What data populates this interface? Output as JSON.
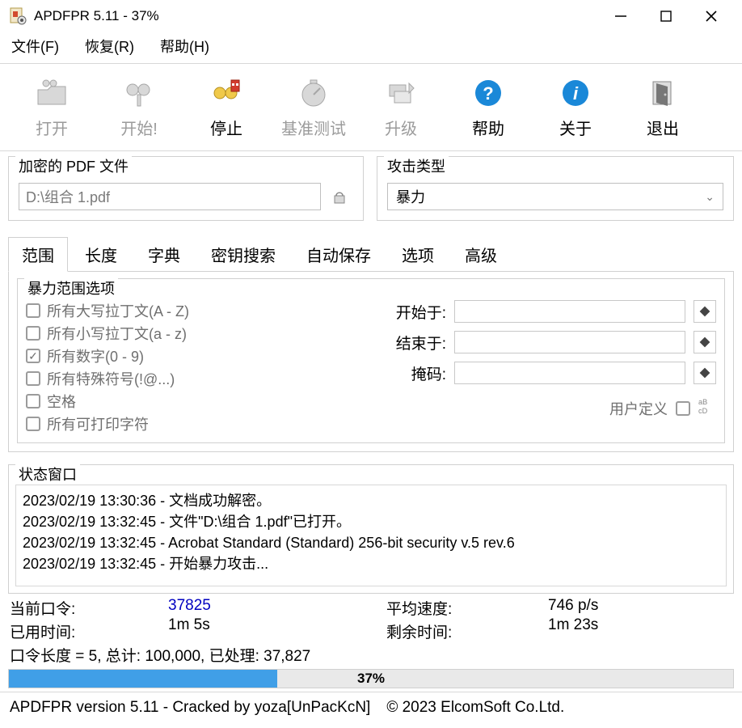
{
  "window": {
    "title": "APDFPR 5.11 - 37%"
  },
  "menu": {
    "file": "文件(F)",
    "recover": "恢复(R)",
    "help": "帮助(H)"
  },
  "toolbar": {
    "open": "打开",
    "start": "开始!",
    "stop": "停止",
    "benchmark": "基准测试",
    "upgrade": "升级",
    "help": "帮助",
    "about": "关于",
    "exit": "退出"
  },
  "groups": {
    "file_legend": "加密的 PDF 文件",
    "file_value": "D:\\组合 1.pdf",
    "attack_legend": "攻击类型",
    "attack_value": "暴力"
  },
  "tabs": {
    "range": "范围",
    "length": "长度",
    "dict": "字典",
    "keysearch": "密钥搜索",
    "autosave": "自动保存",
    "options": "选项",
    "advanced": "高级"
  },
  "brute": {
    "legend": "暴力范围选项",
    "upper": "所有大写拉丁文(A - Z)",
    "lower": "所有小写拉丁文(a - z)",
    "digits": "所有数字(0 - 9)",
    "special": "所有特殊符号(!@...)",
    "space": "空格",
    "printable": "所有可打印字符",
    "start_at": "开始于:",
    "end_at": "结束于:",
    "mask": "掩码:",
    "user_def": "用户定义"
  },
  "status_legend": "状态窗口",
  "status_lines": [
    "2023/02/19 13:30:36 - 文档成功解密。",
    "2023/02/19 13:32:45 - 文件\"D:\\组合 1.pdf\"已打开。",
    "2023/02/19 13:32:45 - Acrobat Standard (Standard) 256-bit security v.5 rev.6",
    "2023/02/19 13:32:45 - 开始暴力攻击..."
  ],
  "summary": {
    "current_pw_label": "当前口令:",
    "current_pw_value": "37825",
    "elapsed_label": "已用时间:",
    "elapsed_value": "1m 5s",
    "speed_label": "平均速度:",
    "speed_value": "746 p/s",
    "remain_label": "剩余时间:",
    "remain_value": "1m 23s",
    "progress_line": "口令长度 = 5, 总计: 100,000, 已处理: 37,827"
  },
  "progress": {
    "percent": 37,
    "label": "37%"
  },
  "footer": {
    "left": "APDFPR version 5.11 - Cracked by yoza[UnPacKcN]",
    "right": "© 2023 ElcomSoft Co.Ltd."
  }
}
